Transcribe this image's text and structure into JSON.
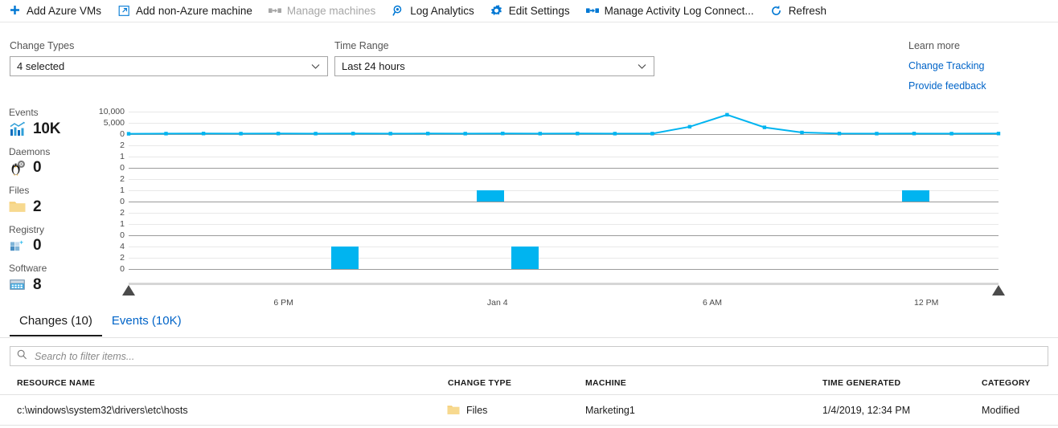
{
  "toolbar": {
    "items": [
      {
        "label": "Add Azure VMs",
        "icon": "plus-icon",
        "disabled": false
      },
      {
        "label": "Add non-Azure machine",
        "icon": "external-link-icon",
        "disabled": false
      },
      {
        "label": "Manage machines",
        "icon": "machines-icon",
        "disabled": true
      },
      {
        "label": "Log Analytics",
        "icon": "magnifier-icon",
        "disabled": false
      },
      {
        "label": "Edit Settings",
        "icon": "gear-icon",
        "disabled": false
      },
      {
        "label": "Manage Activity Log Connect...",
        "icon": "machines-icon",
        "disabled": false
      },
      {
        "label": "Refresh",
        "icon": "refresh-icon",
        "disabled": false
      }
    ]
  },
  "filters": {
    "change_types": {
      "label": "Change Types",
      "value": "4 selected"
    },
    "time_range": {
      "label": "Time Range",
      "value": "Last 24 hours"
    }
  },
  "learn_more": {
    "label": "Learn more",
    "links": [
      "Change Tracking",
      "Provide feedback"
    ]
  },
  "kpis": [
    {
      "title": "Events",
      "value": "10K",
      "icon": "bar-chart-icon"
    },
    {
      "title": "Daemons",
      "value": "0",
      "icon": "penguin-icon"
    },
    {
      "title": "Files",
      "value": "2",
      "icon": "folder-icon"
    },
    {
      "title": "Registry",
      "value": "0",
      "icon": "registry-icon"
    },
    {
      "title": "Software",
      "value": "8",
      "icon": "software-icon"
    }
  ],
  "chart_data": {
    "type": "line",
    "title": "",
    "xlabel": "",
    "ylabel": "",
    "grid": true,
    "legend_position": "none",
    "x_ticks": [
      {
        "label": "6 PM",
        "pos": 0.178
      },
      {
        "label": "Jan 4",
        "pos": 0.424
      },
      {
        "label": "6 AM",
        "pos": 0.671
      },
      {
        "label": "12 PM",
        "pos": 0.917
      }
    ],
    "series_color": "#00b4f0",
    "panels": [
      {
        "name": "Events",
        "type": "line",
        "yticks": [
          "10,000",
          "5,000",
          "0"
        ],
        "ylim": [
          0,
          10000
        ],
        "points": [
          {
            "x": 0.0,
            "y": 150
          },
          {
            "x": 0.043,
            "y": 230
          },
          {
            "x": 0.086,
            "y": 240
          },
          {
            "x": 0.129,
            "y": 200
          },
          {
            "x": 0.172,
            "y": 250
          },
          {
            "x": 0.215,
            "y": 210
          },
          {
            "x": 0.258,
            "y": 260
          },
          {
            "x": 0.301,
            "y": 220
          },
          {
            "x": 0.344,
            "y": 250
          },
          {
            "x": 0.387,
            "y": 230
          },
          {
            "x": 0.43,
            "y": 270
          },
          {
            "x": 0.473,
            "y": 210
          },
          {
            "x": 0.516,
            "y": 240
          },
          {
            "x": 0.559,
            "y": 230
          },
          {
            "x": 0.602,
            "y": 200
          },
          {
            "x": 0.645,
            "y": 3300
          },
          {
            "x": 0.688,
            "y": 8600
          },
          {
            "x": 0.731,
            "y": 3000
          },
          {
            "x": 0.774,
            "y": 700
          },
          {
            "x": 0.817,
            "y": 250
          },
          {
            "x": 0.86,
            "y": 230
          },
          {
            "x": 0.903,
            "y": 240
          },
          {
            "x": 0.946,
            "y": 220
          },
          {
            "x": 1.0,
            "y": 250
          }
        ]
      },
      {
        "name": "Daemons",
        "type": "bar",
        "yticks": [
          "2",
          "1",
          "0"
        ],
        "ylim": [
          0,
          2
        ],
        "bars": []
      },
      {
        "name": "Files",
        "type": "bar",
        "yticks": [
          "2",
          "1",
          "0"
        ],
        "ylim": [
          0,
          2
        ],
        "bars": [
          {
            "x": 0.4,
            "value": 1
          },
          {
            "x": 0.889,
            "value": 1
          }
        ]
      },
      {
        "name": "Registry",
        "type": "bar",
        "yticks": [
          "2",
          "1",
          "0"
        ],
        "ylim": [
          0,
          2
        ],
        "bars": []
      },
      {
        "name": "Software",
        "type": "bar",
        "yticks": [
          "4",
          "2",
          "0"
        ],
        "ylim": [
          0,
          4
        ],
        "bars": [
          {
            "x": 0.233,
            "value": 4
          },
          {
            "x": 0.44,
            "value": 4
          }
        ]
      }
    ]
  },
  "tabs": [
    {
      "label": "Changes (10)",
      "active": true
    },
    {
      "label": "Events (10K)",
      "active": false
    }
  ],
  "search": {
    "placeholder": "Search to filter items...",
    "value": ""
  },
  "table": {
    "columns": [
      "RESOURCE NAME",
      "CHANGE TYPE",
      "MACHINE",
      "TIME GENERATED",
      "CATEGORY"
    ],
    "rows": [
      {
        "resource_name": "c:\\windows\\system32\\drivers\\etc\\hosts",
        "change_type": "Files",
        "change_type_icon": "folder-icon",
        "machine": "Marketing1",
        "time_generated": "1/4/2019, 12:34 PM",
        "category": "Modified"
      }
    ]
  },
  "colors": {
    "accent": "#00b4f0",
    "link": "#0064c8",
    "azure_blue": "#0078d4",
    "folder": "#f5cf78"
  }
}
